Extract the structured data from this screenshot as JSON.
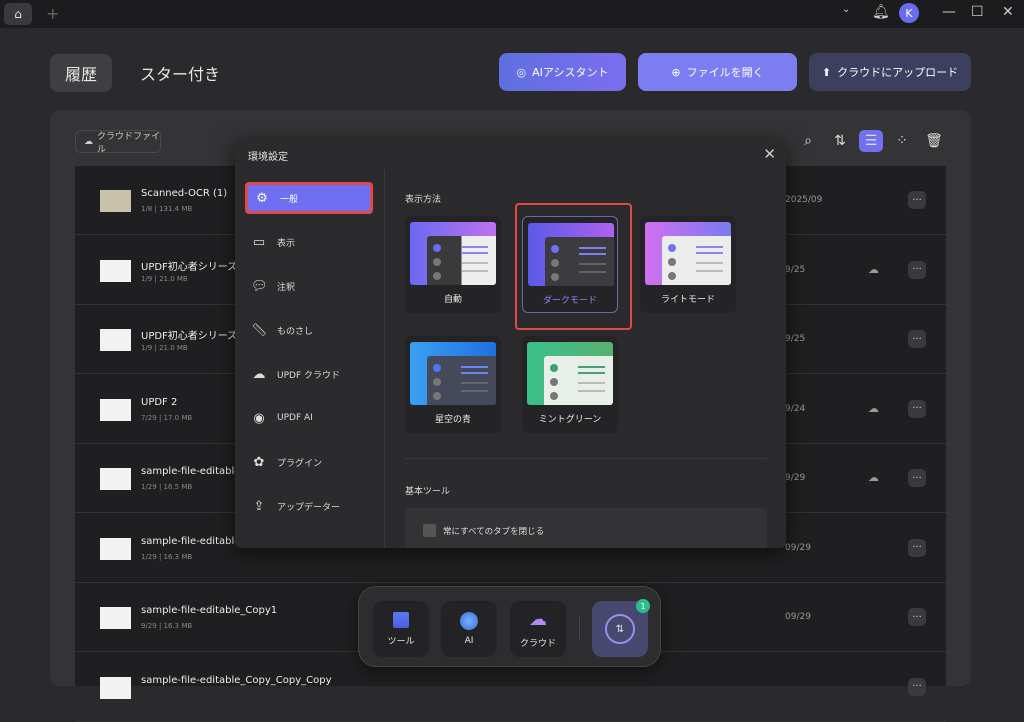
{
  "titlebar": {
    "avatar": "K"
  },
  "tabs": [
    {
      "label": "履歴"
    },
    {
      "label": "スター付き"
    }
  ],
  "actions": {
    "ai": "AIアシスタント",
    "open": "ファイルを開く",
    "upload": "クラウドにアップロード"
  },
  "toolbar": {
    "cloud_files": "クラウドファイル"
  },
  "files": [
    {
      "name": "Scanned-OCR (1)",
      "meta": "1/8 | 131.4 MB",
      "date": "2025/09",
      "cloud": false
    },
    {
      "name": "UPDF初心者シリーズ",
      "meta": "1/9 | 21.0 MB",
      "date": "9/25",
      "cloud": true
    },
    {
      "name": "UPDF初心者シリーズ",
      "meta": "1/9 | 21.0 MB",
      "date": "9/25",
      "cloud": false
    },
    {
      "name": "UPDF 2",
      "meta": "7/29 | 17.0 MB",
      "date": "9/24",
      "cloud": true
    },
    {
      "name": "sample-file-editable",
      "meta": "1/29 | 16.5 MB",
      "date": "9/29",
      "cloud": true
    },
    {
      "name": "sample-file-editable_Copy",
      "meta": "1/29 | 16.3 MB",
      "date": "09/29",
      "cloud": false
    },
    {
      "name": "sample-file-editable_Copy1",
      "meta": "9/29 | 16.3 MB",
      "date": "09/29",
      "cloud": false
    },
    {
      "name": "sample-file-editable_Copy_Copy_Copy",
      "meta": "",
      "date": "",
      "cloud": false
    }
  ],
  "dialog": {
    "title": "環境設定",
    "sidebar": [
      {
        "label": "一般",
        "icon": "gear"
      },
      {
        "label": "表示",
        "icon": "layout"
      },
      {
        "label": "注釈",
        "icon": "comment"
      },
      {
        "label": "ものさし",
        "icon": "ruler"
      },
      {
        "label": "UPDF クラウド",
        "icon": "cloud"
      },
      {
        "label": "UPDF AI",
        "icon": "ai"
      },
      {
        "label": "プラグイン",
        "icon": "plugin"
      },
      {
        "label": "アップデーター",
        "icon": "update"
      }
    ],
    "display_heading": "表示方法",
    "themes": [
      {
        "label": "自動"
      },
      {
        "label": "ダークモード",
        "selected": true
      },
      {
        "label": "ライトモード"
      },
      {
        "label": "星空の青"
      },
      {
        "label": "ミントグリーン"
      }
    ],
    "tools_heading": "基本ツール",
    "close_all_tabs": "常にすべてのタブを閉じる"
  },
  "dock": {
    "tools": "ツール",
    "ai": "AI",
    "cloud": "クラウド",
    "badge": "1"
  }
}
